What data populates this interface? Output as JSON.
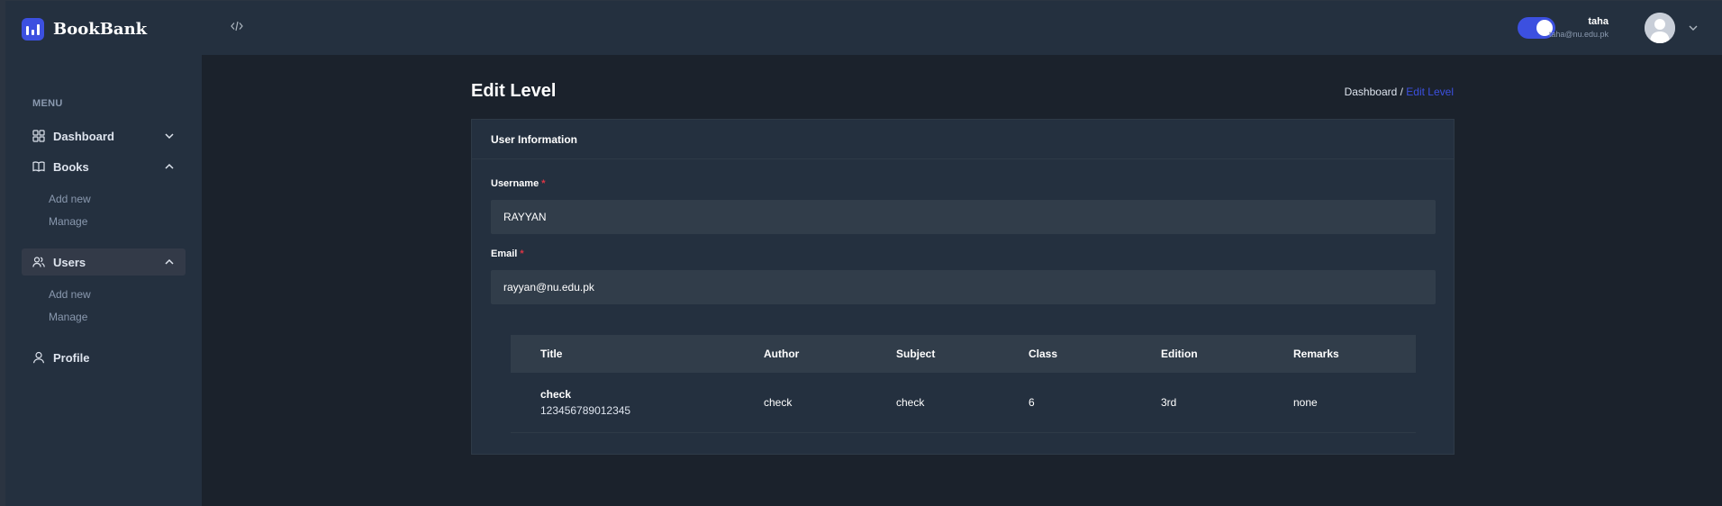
{
  "app": {
    "logo_text": "BookBank",
    "accent_color": "#3c50e0"
  },
  "sidebar": {
    "menu_heading": "MENU",
    "items": [
      {
        "label": "Dashboard",
        "icon": "grid-icon",
        "expanded": false
      },
      {
        "label": "Books",
        "icon": "book-icon",
        "expanded": true,
        "children": [
          {
            "label": "Add new"
          },
          {
            "label": "Manage"
          }
        ]
      },
      {
        "label": "Users",
        "icon": "users-icon",
        "expanded": true,
        "active": true,
        "children": [
          {
            "label": "Add new"
          },
          {
            "label": "Manage"
          }
        ]
      },
      {
        "label": "Profile",
        "icon": "user-icon"
      }
    ]
  },
  "header": {
    "sidebar_toggle_icon": "code-icon",
    "dark_mode_toggle": true,
    "user": {
      "name": "taha",
      "email": "taha@nu.edu.pk"
    }
  },
  "page": {
    "title": "Edit Level",
    "breadcrumb": {
      "parent": "Dashboard /",
      "current": "Edit Level"
    }
  },
  "form": {
    "section_title": "User Information",
    "username": {
      "label": "Username",
      "required_mark": "*",
      "value": "RAYYAN"
    },
    "email": {
      "label": "Email",
      "required_mark": "*",
      "value": "rayyan@nu.edu.pk"
    }
  },
  "table": {
    "headers": [
      "Title",
      "Author",
      "Subject",
      "Class",
      "Edition",
      "Remarks"
    ],
    "rows": [
      {
        "title": "check",
        "isbn": "123456789012345",
        "author": "check",
        "subject": "check",
        "class": "6",
        "edition": "3rd",
        "remarks": "none"
      }
    ]
  }
}
